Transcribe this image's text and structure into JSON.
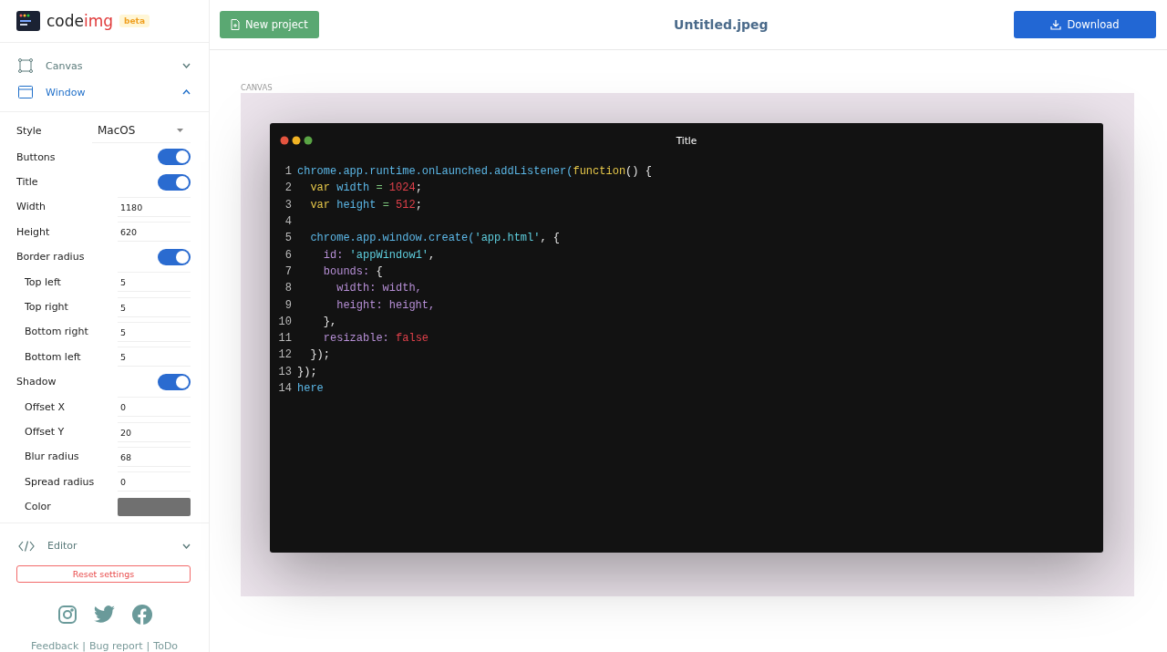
{
  "brand": {
    "name_a": "code",
    "name_b": "img",
    "badge": "beta"
  },
  "header": {
    "new_button": "New project",
    "file_title": "Untitled.jpeg",
    "download_button": "Download"
  },
  "sections": [
    {
      "label": "Canvas",
      "expanded": false
    },
    {
      "label": "Window",
      "expanded": true
    }
  ],
  "settings": [
    {
      "kind": "select",
      "label": "Style",
      "value": "MacOS"
    },
    {
      "kind": "toggle",
      "label": "Buttons",
      "on": true
    },
    {
      "kind": "toggle",
      "label": "Title",
      "on": true
    },
    {
      "kind": "input",
      "label": "Width",
      "value": "1180"
    },
    {
      "kind": "input",
      "label": "Height",
      "value": "620"
    },
    {
      "kind": "toggle",
      "label": "Border radius",
      "on": true,
      "children": [
        {
          "kind": "input",
          "label": "Top left",
          "value": "5"
        },
        {
          "kind": "input",
          "label": "Top right",
          "value": "5"
        },
        {
          "kind": "input",
          "label": "Bottom right",
          "value": "5"
        },
        {
          "kind": "input",
          "label": "Bottom left",
          "value": "5"
        }
      ]
    },
    {
      "kind": "toggle",
      "label": "Shadow",
      "on": true,
      "children": [
        {
          "kind": "input",
          "label": "Offset X",
          "value": "0"
        },
        {
          "kind": "input",
          "label": "Offset Y",
          "value": "20"
        },
        {
          "kind": "input",
          "label": "Blur radius",
          "value": "68"
        },
        {
          "kind": "input",
          "label": "Spread radius",
          "value": "0"
        },
        {
          "kind": "color",
          "label": "Color",
          "color": "#707070"
        }
      ]
    }
  ],
  "editor_section": {
    "label": "Editor",
    "expanded": false
  },
  "reset_button": "Reset settings",
  "footer_links": [
    "Feedback",
    "Bug report",
    "ToDo"
  ],
  "footer_separators": [
    "|",
    "|"
  ],
  "canvas_label": "CANVAS",
  "code_window": {
    "title": "Title",
    "lines": [
      {
        "number": "1",
        "tokens": [
          {
            "text": "chrome",
            "kind": "obj"
          },
          {
            "text": ".app.runtime.onLaunched.addListener(",
            "kind": "obj"
          },
          {
            "text": "function",
            "kind": "kw"
          },
          {
            "text": "() {",
            "kind": "plain"
          }
        ]
      },
      {
        "number": "2",
        "tokens": [
          {
            "text": "  var",
            "kind": "kw"
          },
          {
            "text": " width",
            "kind": "obj"
          },
          {
            "text": " =",
            "kind": "op"
          },
          {
            "text": " 1024",
            "kind": "num"
          },
          {
            "text": ";",
            "kind": "plain"
          }
        ]
      },
      {
        "number": "3",
        "tokens": [
          {
            "text": "  var",
            "kind": "kw"
          },
          {
            "text": " height",
            "kind": "obj"
          },
          {
            "text": " =",
            "kind": "op"
          },
          {
            "text": " 512",
            "kind": "num"
          },
          {
            "text": ";",
            "kind": "plain"
          }
        ]
      },
      {
        "number": "4"
      },
      {
        "number": "5",
        "tokens": [
          {
            "text": "  chrome.app.window.create(",
            "kind": "obj"
          },
          {
            "text": "'app.html'",
            "kind": "str"
          },
          {
            "text": ", {",
            "kind": "plain"
          }
        ]
      },
      {
        "number": "6",
        "tokens": [
          {
            "text": "    id:",
            "kind": "prop"
          },
          {
            "text": " 'appWindow1'",
            "kind": "str"
          },
          {
            "text": ",",
            "kind": "plain"
          }
        ]
      },
      {
        "number": "7",
        "tokens": [
          {
            "text": "    bounds:",
            "kind": "prop"
          },
          {
            "text": " {",
            "kind": "plain"
          }
        ]
      },
      {
        "number": "8",
        "tokens": [
          {
            "text": "      width: width,",
            "kind": "prop"
          }
        ]
      },
      {
        "number": "9",
        "tokens": [
          {
            "text": "      height: height,",
            "kind": "prop"
          }
        ]
      },
      {
        "number": "10",
        "tokens": [
          {
            "text": "    },",
            "kind": "plain"
          }
        ]
      },
      {
        "number": "11",
        "tokens": [
          {
            "text": "    resizable:",
            "kind": "prop"
          },
          {
            "text": " false",
            "kind": "num"
          }
        ]
      },
      {
        "number": "12",
        "tokens": [
          {
            "text": "  });",
            "kind": "plain"
          }
        ]
      },
      {
        "number": "13",
        "tokens": [
          {
            "text": "});",
            "kind": "plain"
          }
        ]
      },
      {
        "number": "14",
        "tokens": [
          {
            "text": "here",
            "kind": "obj"
          }
        ]
      }
    ]
  }
}
